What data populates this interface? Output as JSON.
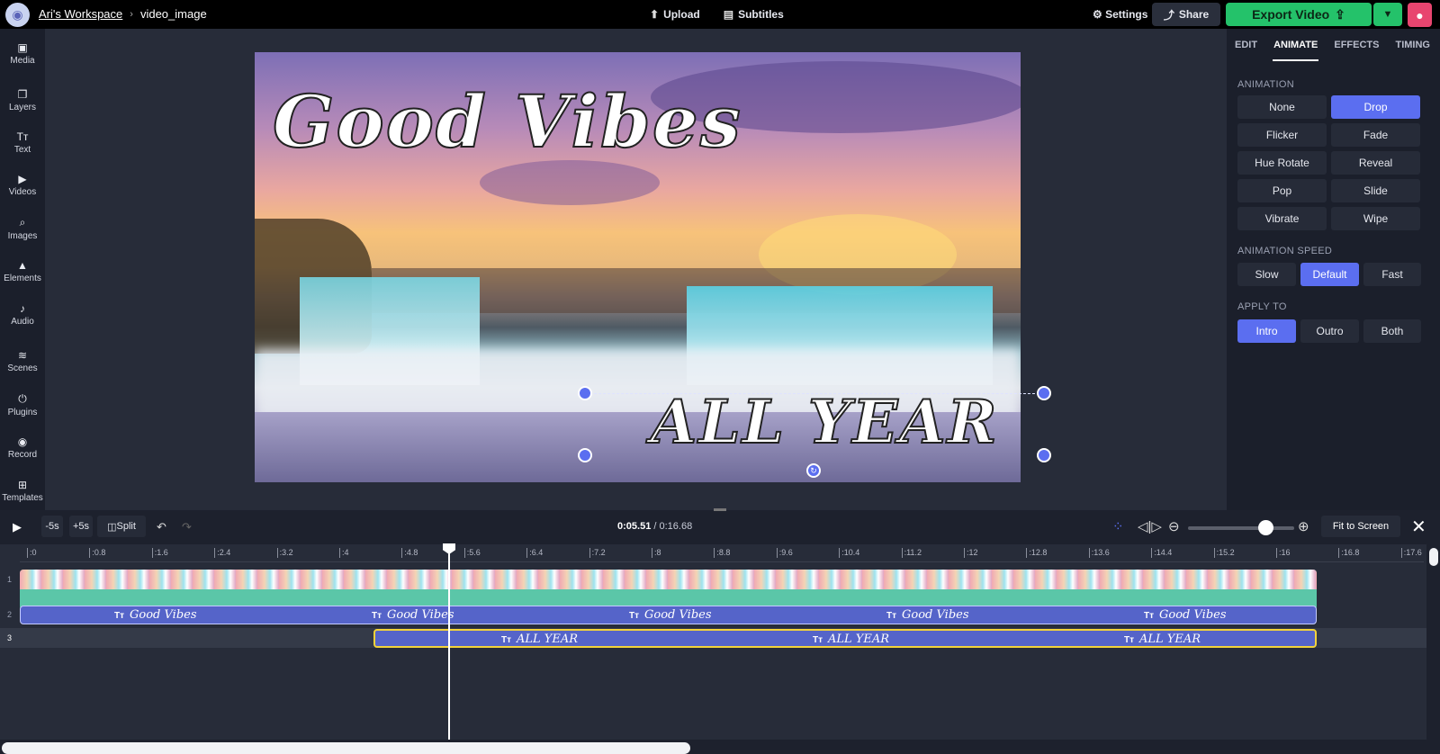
{
  "header": {
    "workspace": "Ari's Workspace",
    "separator": "›",
    "project": "video_image",
    "upload": "Upload",
    "subtitles": "Subtitles",
    "settings": "Settings",
    "share": "Share",
    "export": "Export Video"
  },
  "sidebar": {
    "items": [
      {
        "label": "Media",
        "icon": "media-icon"
      },
      {
        "label": "Layers",
        "icon": "layers-icon"
      },
      {
        "label": "Text",
        "icon": "text-icon"
      },
      {
        "label": "Videos",
        "icon": "videos-icon"
      },
      {
        "label": "Images",
        "icon": "images-icon"
      },
      {
        "label": "Elements",
        "icon": "elements-icon"
      },
      {
        "label": "Audio",
        "icon": "audio-icon"
      },
      {
        "label": "Scenes",
        "icon": "scenes-icon"
      },
      {
        "label": "Plugins",
        "icon": "plugins-icon"
      },
      {
        "label": "Record",
        "icon": "record-icon"
      },
      {
        "label": "Templates",
        "icon": "templates-icon"
      }
    ]
  },
  "canvas": {
    "text_top": "Good Vibes",
    "text_bottom": "ALL YEAR"
  },
  "panel": {
    "tabs": [
      "EDIT",
      "ANIMATE",
      "EFFECTS",
      "TIMING"
    ],
    "active_tab": "ANIMATE",
    "animation_label": "ANIMATION",
    "animations": [
      "None",
      "Drop",
      "Flicker",
      "Fade",
      "Hue Rotate",
      "Reveal",
      "Pop",
      "Slide",
      "Vibrate",
      "Wipe"
    ],
    "selected_animation": "Drop",
    "speed_label": "ANIMATION SPEED",
    "speeds": [
      "Slow",
      "Default",
      "Fast"
    ],
    "selected_speed": "Default",
    "apply_label": "APPLY TO",
    "apply": [
      "Intro",
      "Outro",
      "Both"
    ],
    "selected_apply": "Intro",
    "accent_color": "#5b6ef0"
  },
  "timeline": {
    "back": "-5s",
    "forward": "+5s",
    "split": "Split",
    "current_time": "0:05.51",
    "total_time": "/ 0:16.68",
    "fit": "Fit to Screen",
    "ruler": [
      ":0",
      ":0.8",
      ":1.6",
      ":2.4",
      ":3.2",
      ":4",
      ":4.8",
      ":5.6",
      ":6.4",
      ":7.2",
      ":8",
      ":8.8",
      ":9.6",
      ":10.4",
      ":11.2",
      ":12",
      ":12.8",
      ":13.6",
      ":14.4",
      ":15.2",
      ":16",
      ":16.8",
      ":17.6"
    ],
    "tracks": [
      "1",
      "2",
      "3"
    ],
    "track2_label": "Good Vibes",
    "track3_label": "ALL YEAR",
    "tt_icon": "Tт"
  }
}
